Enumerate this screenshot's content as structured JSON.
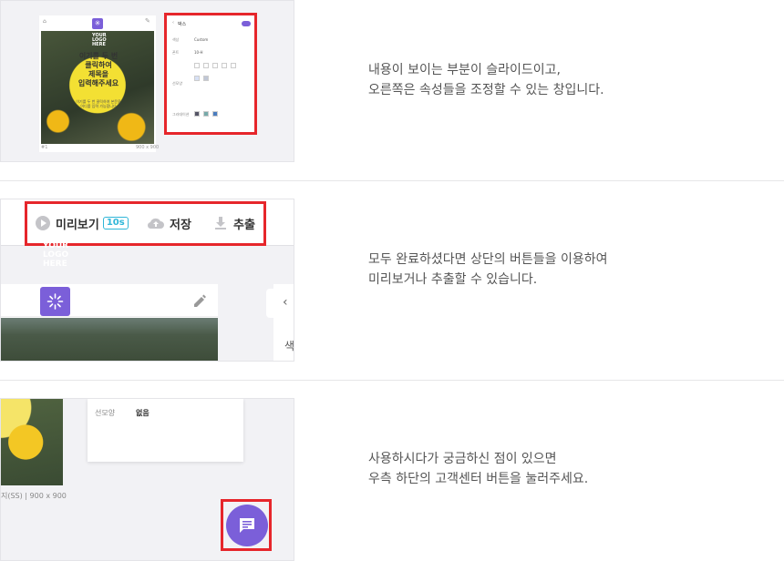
{
  "section1": {
    "panel_title": "박스",
    "rows": [
      {
        "label": "색상",
        "value": "Custom"
      },
      {
        "label": "폰트",
        "value": "10-H"
      },
      {
        "label": "",
        "value": ""
      },
      {
        "label": "",
        "value": ""
      },
      {
        "label": "선모양",
        "value": ""
      },
      {
        "label": "",
        "value": ""
      },
      {
        "label": "그라데이션",
        "value": ""
      }
    ],
    "canvas_title": "이기를 두 번\n클릭하여\n제목을\n입력해주세요",
    "canvas_sub": "이기를 두 번 클릭하여 본문을\n어디를 입력 가능합니다",
    "canvas_logo": "YOUR\nLOGO\nHERE",
    "page_num": "#1",
    "size_text": "900 x 900",
    "description": "내용이 보이는 부분이 슬라이드이고,\n오른쪽은 속성들을 조정할 수 있는 창입니다."
  },
  "section2": {
    "preview_label": "미리보기",
    "preview_badge": "10s",
    "save_label": "저장",
    "export_label": "추출",
    "logo_text": "YOUR\nLOGO\nHERE",
    "side_text": "색",
    "description": "모두 완료하셨다면 상단의 버튼들을 이용하여\n미리보거나 추출할 수 있습니다."
  },
  "section3": {
    "popup_label": "선모양",
    "popup_value": "없음",
    "meta_text": "지(SS)  |  900 x 900",
    "description": "사용하시다가 궁금하신 점이 있으면\n우측 하단의 고객센터 버튼을 눌러주세요."
  },
  "colors": {
    "accent": "#7b5fd9",
    "highlight_border": "#e6262b",
    "badge": "#2fb6d8"
  }
}
